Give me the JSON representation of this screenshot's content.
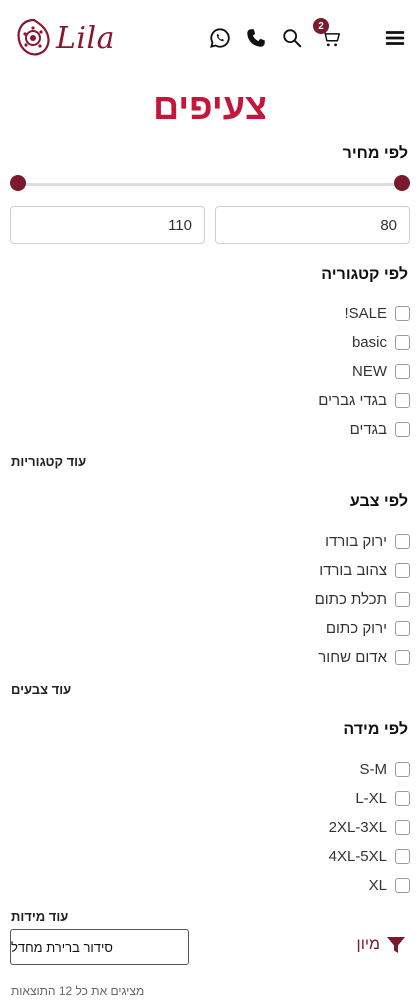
{
  "header": {
    "logo_text": "Lila",
    "cart_count": "2",
    "icons": [
      "whatsapp-icon",
      "phone-icon",
      "search-icon",
      "cart-icon",
      "menu-icon"
    ]
  },
  "page_title": "צעיפים",
  "price_filter": {
    "title": "לפי מחיר",
    "min_value": "80",
    "max_value": "110"
  },
  "category_filter": {
    "title": "לפי קטגוריה",
    "items": [
      "SALE!",
      "basic",
      "NEW",
      "בגדי גברים",
      "בגדים"
    ],
    "more_label": "עוד קטגוריות"
  },
  "color_filter": {
    "title": "לפי צבע",
    "items": [
      "ירוק בורדו",
      "צהוב בורדו",
      "תכלת כתום",
      "ירוק כתום",
      "אדום שחור"
    ],
    "more_label": "עוד צבעים"
  },
  "size_filter": {
    "title": "לפי מידה",
    "items": [
      "S-M",
      "L-XL",
      "2XL-3XL",
      "4XL-5XL",
      "XL"
    ],
    "more_label": "עוד מידות"
  },
  "toolbar": {
    "sort_label": "סידור ברירת מחדל",
    "filter_label": "מיון",
    "results_text": "מציגים את כל 12 התוצאות"
  },
  "colors": {
    "brand": "#7b1a2c",
    "title": "#c4163b"
  }
}
